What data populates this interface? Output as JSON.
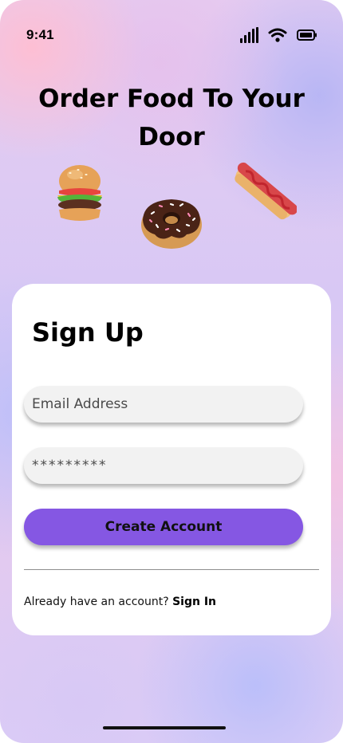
{
  "status_bar": {
    "time": "9:41",
    "icons": [
      "cellular-signal-icon",
      "wifi-icon",
      "battery-icon"
    ]
  },
  "hero": {
    "headline": "Order Food To Your Door",
    "illustrations": [
      "burger-icon",
      "donut-icon",
      "hotdog-icon"
    ]
  },
  "signup": {
    "title": "Sign Up",
    "email": {
      "placeholder": "Email Address",
      "value": ""
    },
    "password": {
      "value": "*********"
    },
    "create_button": "Create Account",
    "signin_prompt": "Already have an account?",
    "signin_link": "Sign In"
  },
  "colors": {
    "accent": "#8557e3",
    "card": "#ffffff",
    "field_bg": "#f2f2f2"
  }
}
